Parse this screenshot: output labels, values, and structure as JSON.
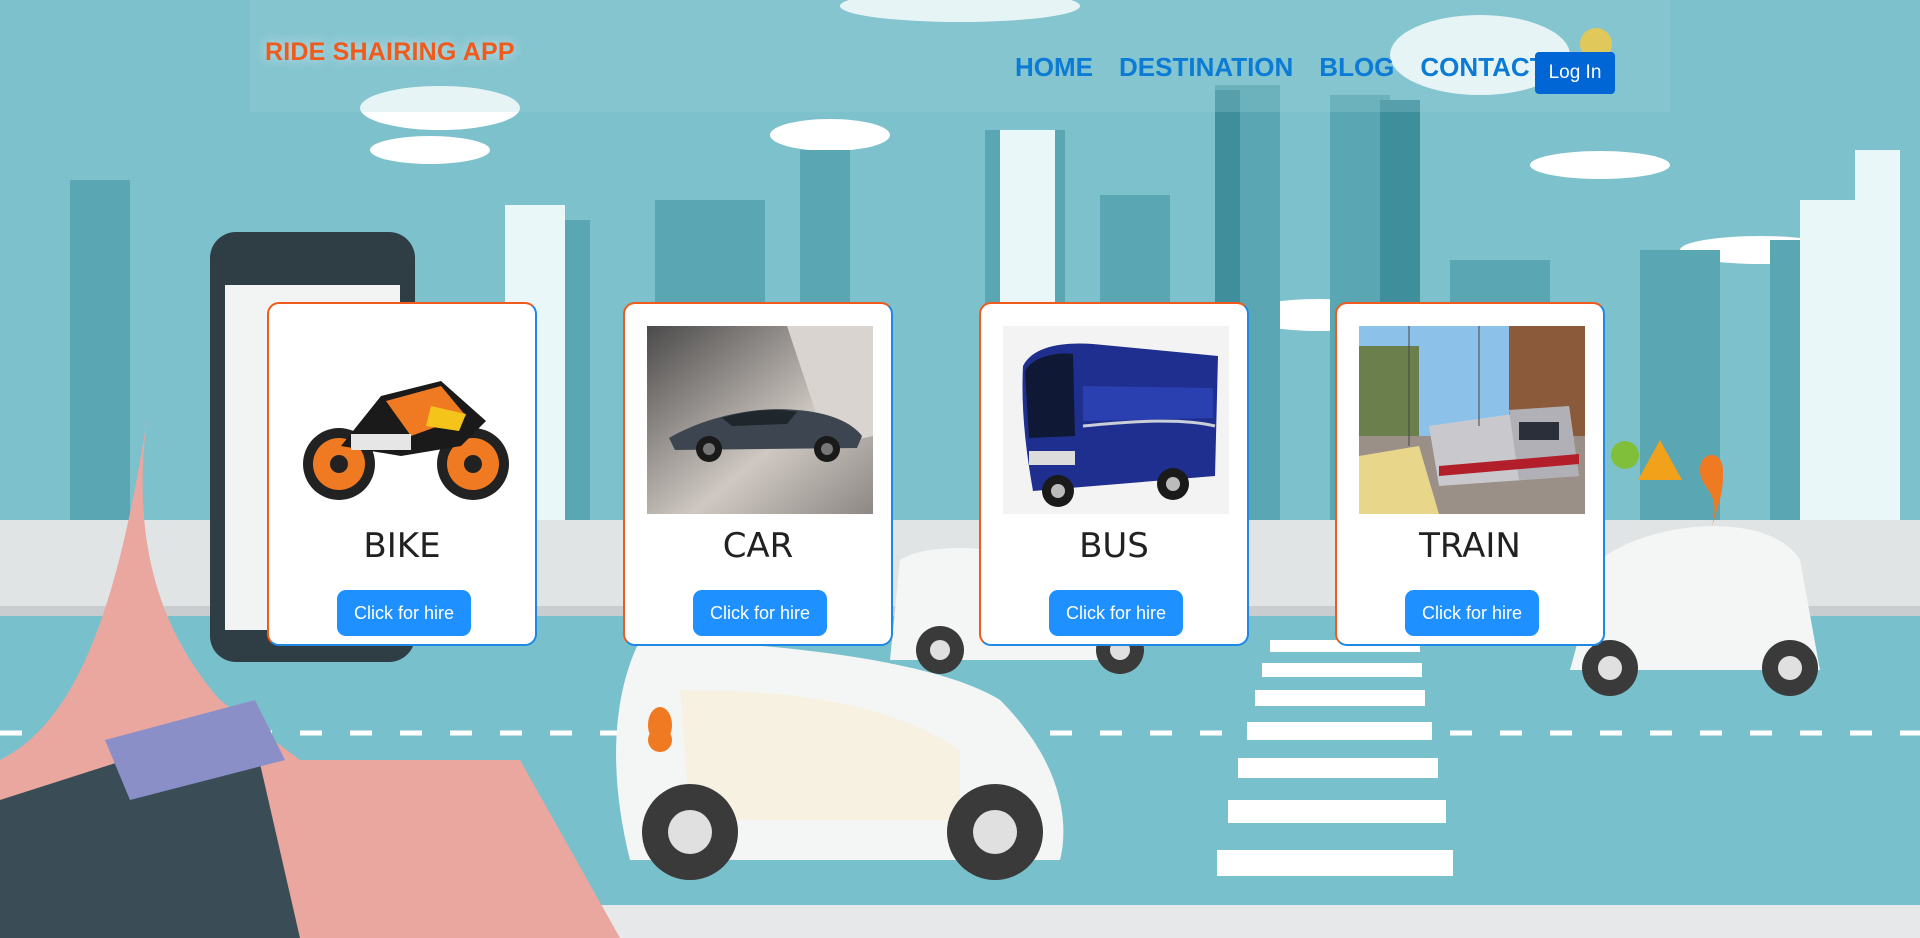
{
  "header": {
    "brand": "RIDE SHAIRING APP",
    "nav": [
      "HOME",
      "DESTINATION",
      "BLOG",
      "CONTACT"
    ],
    "login_label": "Log In"
  },
  "cards": [
    {
      "title": "BIKE",
      "button": "Click for hire",
      "image": "motorbike-photo"
    },
    {
      "title": "CAR",
      "button": "Click for hire",
      "image": "car-photo"
    },
    {
      "title": "BUS",
      "button": "Click for hire",
      "image": "bus-photo"
    },
    {
      "title": "TRAIN",
      "button": "Click for hire",
      "image": "train-photo"
    }
  ],
  "colors": {
    "brand": "#f05a1c",
    "nav": "#0b7bd6",
    "login_button": "#0066d6",
    "hire_button": "#1e90ff",
    "background": "#7dc1cd"
  }
}
